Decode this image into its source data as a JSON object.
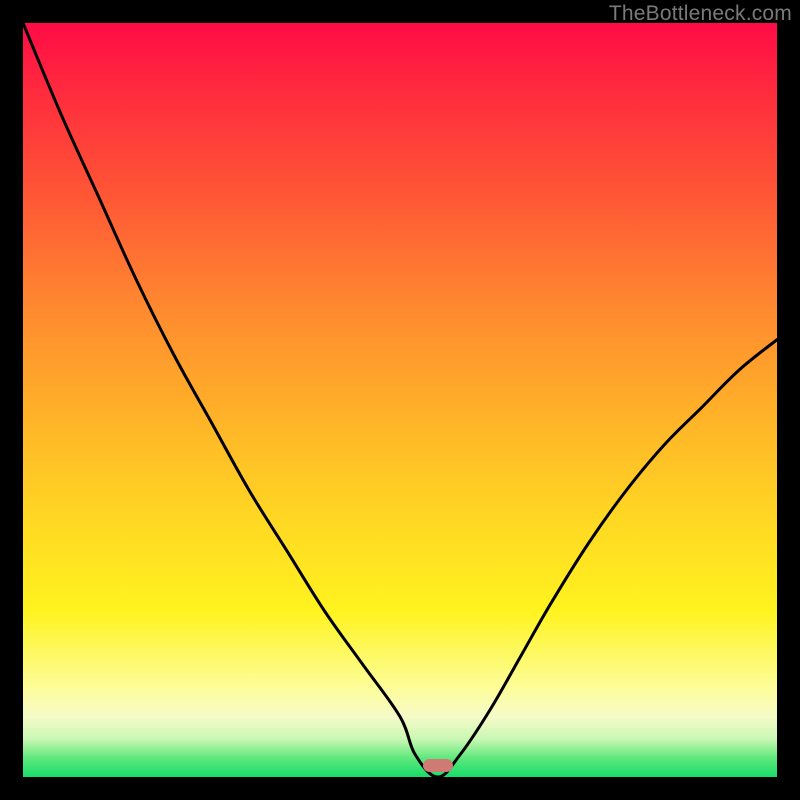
{
  "watermark": "TheBottleneck.com",
  "colors": {
    "frame": "#000000",
    "gradient_top": "#ff0b46",
    "gradient_bottom": "#17dd6a",
    "curve": "#000000",
    "marker": "#cf7a72",
    "watermark": "#7a7a7a"
  },
  "chart_data": {
    "type": "line",
    "title": "",
    "xlabel": "",
    "ylabel": "",
    "xlim": [
      0,
      100
    ],
    "ylim": [
      0,
      100
    ],
    "grid": false,
    "legend": false,
    "series": [
      {
        "name": "bottleneck-curve",
        "x": [
          0,
          5,
          10,
          15,
          20,
          25,
          30,
          35,
          40,
          45,
          50,
          52,
          55,
          58,
          62,
          66,
          70,
          75,
          80,
          85,
          90,
          95,
          100
        ],
        "values": [
          100,
          88,
          77,
          66,
          56,
          47,
          38,
          30,
          22,
          15,
          8,
          3,
          0,
          3,
          9,
          16,
          23,
          31,
          38,
          44,
          49,
          54,
          58
        ]
      }
    ],
    "annotations": [
      {
        "name": "optimum-marker",
        "x": 55,
        "y": 1.5
      }
    ]
  }
}
